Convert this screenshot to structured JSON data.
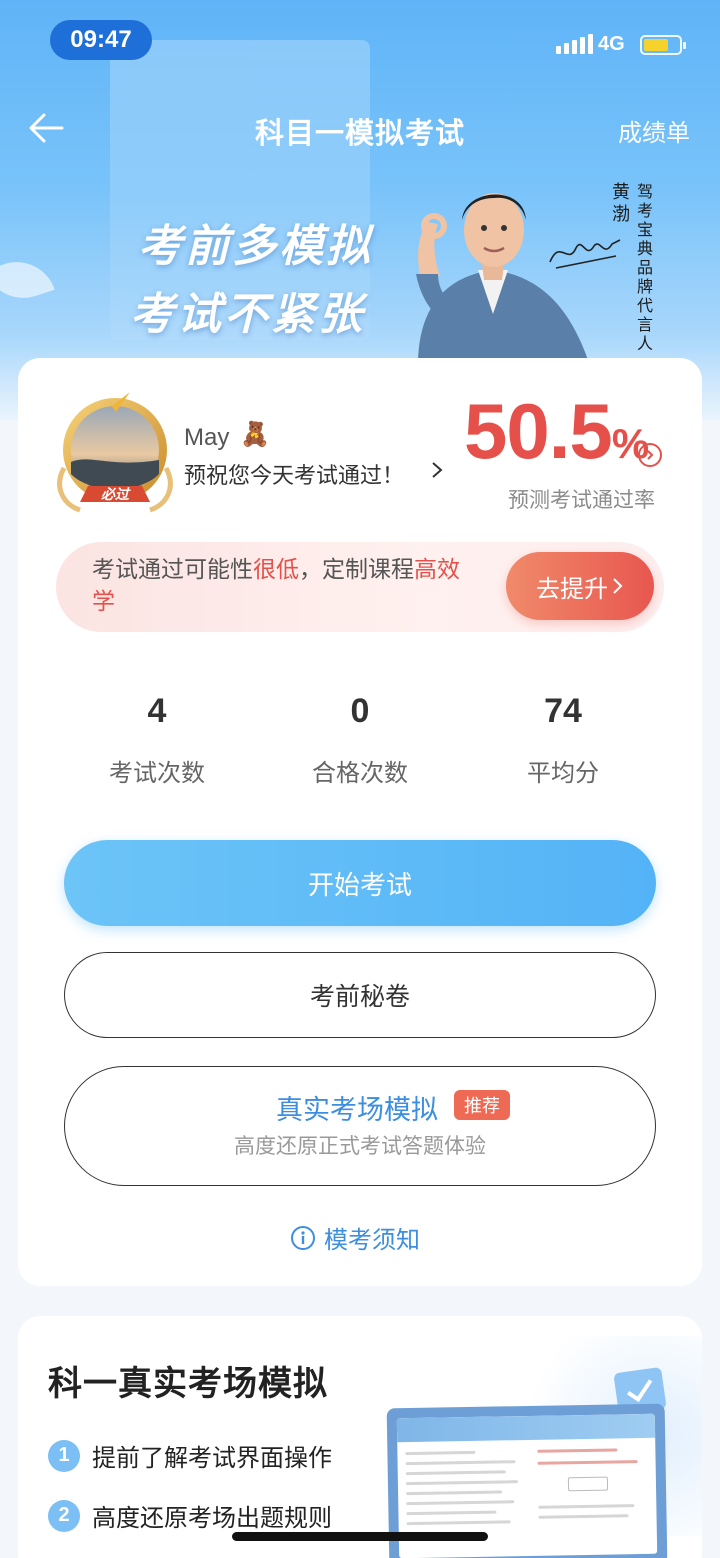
{
  "status_bar": {
    "time": "09:47",
    "network": "4G"
  },
  "nav": {
    "title": "科目一模拟考试",
    "report_link": "成绩单"
  },
  "banner": {
    "slogan_line1": "考前多模拟",
    "slogan_line2": "考试不紧张",
    "endorser_name": "黄渤",
    "endorser_title": "驾考宝典品牌代言人"
  },
  "profile": {
    "avatar_badge": "必过",
    "username": "May",
    "username_emoji": "🧸",
    "wish": "预祝您今天考试通过！"
  },
  "prediction": {
    "rate_value": "50.5",
    "rate_unit": "%",
    "label": "预测考试通过率"
  },
  "advice": {
    "text_prefix": "考试通过可能性",
    "text_highlight1": "很低",
    "text_middle": "，定制课程",
    "text_highlight2": "高效学",
    "button_label": "去提升"
  },
  "stats": [
    {
      "value": "4",
      "label": "考试次数"
    },
    {
      "value": "0",
      "label": "合格次数"
    },
    {
      "value": "74",
      "label": "平均分"
    }
  ],
  "actions": {
    "start_exam": "开始考试",
    "secret_paper": "考前秘卷",
    "real_sim_title": "真实考场模拟",
    "real_sim_badge": "推荐",
    "real_sim_subtitle": "高度还原正式考试答题体验",
    "notice_link": "模考须知"
  },
  "real_sim_section": {
    "title": "科一真实考场模拟",
    "features": [
      {
        "num": "1",
        "text": "提前了解考试界面操作"
      },
      {
        "num": "2",
        "text": "高度还原考场出题规则"
      }
    ]
  },
  "colors": {
    "accent_blue": "#54b3f7",
    "alert_red": "#e5514a",
    "link_blue": "#3c8ee0"
  }
}
